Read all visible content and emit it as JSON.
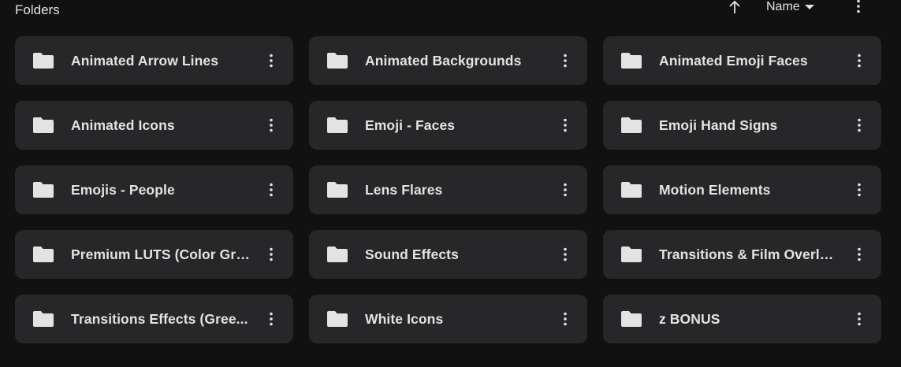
{
  "header": {
    "section_title": "Folders",
    "sort_field_label": "Name",
    "sort_direction_icon": "arrow-up-icon",
    "sort_dropdown_icon": "caret-down-icon",
    "more_icon": "more-vert-icon"
  },
  "colors": {
    "background": "#111112",
    "card_background": "#27272a",
    "text": "#e3e3e3",
    "icon": "#e3e3e3"
  },
  "folders": [
    {
      "name": "Animated Arrow Lines"
    },
    {
      "name": "Animated Backgrounds"
    },
    {
      "name": "Animated Emoji Faces"
    },
    {
      "name": "Animated Icons"
    },
    {
      "name": "Emoji - Faces"
    },
    {
      "name": "Emoji Hand Signs"
    },
    {
      "name": "Emojis - People"
    },
    {
      "name": "Lens Flares"
    },
    {
      "name": "Motion Elements"
    },
    {
      "name": "Premium LUTS (Color Gra..."
    },
    {
      "name": "Sound Effects"
    },
    {
      "name": "Transitions & Film Overlays"
    },
    {
      "name": "Transitions Effects (Gree..."
    },
    {
      "name": "White Icons"
    },
    {
      "name": "z BONUS"
    }
  ]
}
